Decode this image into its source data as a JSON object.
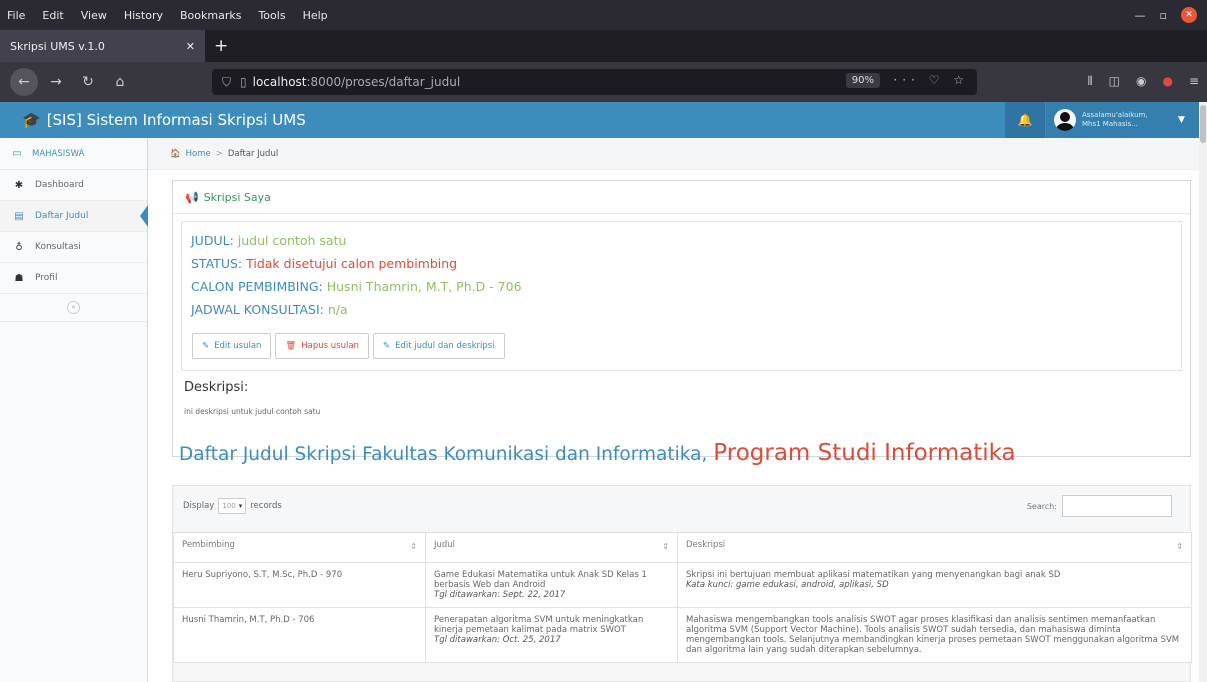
{
  "browser": {
    "menu": [
      "File",
      "Edit",
      "View",
      "History",
      "Bookmarks",
      "Tools",
      "Help"
    ],
    "tab_title": "Skripsi UMS v.1.0",
    "url_host": "localhost",
    "url_path": ":8000/proses/daftar_judul",
    "zoom": "90%"
  },
  "header": {
    "brand": "[SIS] Sistem Informasi Skripsi UMS",
    "user_line1": "Assalamu'alaikum,",
    "user_line2": "Mhs1 Mahasis..."
  },
  "sidebar": {
    "section": "MAHASISWA",
    "items": [
      {
        "label": "Dashboard"
      },
      {
        "label": "Daftar Judul"
      },
      {
        "label": "Konsultasi"
      },
      {
        "label": "Profil"
      }
    ]
  },
  "breadcrumb": {
    "home": "Home",
    "sep": ">",
    "current": "Daftar Judul"
  },
  "skripsi": {
    "title": "Skripsi Saya",
    "judul_label": "JUDUL:",
    "judul_value": "judul contoh satu",
    "status_label": "STATUS:",
    "status_value": "Tidak disetujui calon pembimbing",
    "calon_label": "CALON PEMBIMBING:",
    "calon_value": "Husni Thamrin, M.T, Ph.D - 706",
    "jadwal_label": "JADWAL KONSULTASI:",
    "jadwal_value": "n/a",
    "btn_edit_usulan": "Edit usulan",
    "btn_hapus_usulan": "Hapus usulan",
    "btn_edit_judul": "Edit judul dan deskripsi",
    "deskripsi_label": "Deskripsi:",
    "deskripsi_text": "ini deskripsi untuk judul contoh satu"
  },
  "daftar": {
    "heading": "Daftar Judul Skripsi Fakultas Komunikasi dan Informatika,",
    "program": "Program Studi Informatika",
    "display_label": "Display",
    "display_value": "100",
    "records_label": "records",
    "search_label": "Search:",
    "columns": [
      "Pembimbing",
      "Judul",
      "Deskripsi"
    ],
    "rows": [
      {
        "pembimbing": "Heru Supriyono, S.T, M.Sc, Ph.D - 970",
        "judul": "Game Edukasi Matematika untuk Anak SD Kelas 1 berbasis Web dan Android",
        "tgl": "Tgl ditawarkan: Sept. 22, 2017",
        "deskripsi": "Skripsi ini bertujuan membuat aplikasi matematikan yang menyenangkan bagi anak SD",
        "kata_kunci": "Kata kunci: game edukasi, android, aplikasi, SD"
      },
      {
        "pembimbing": "Husni Thamrin, M.T, Ph.D - 706",
        "judul": "Penerapatan algoritma SVM untuk meningkatkan kinerja pemetaan kalimat pada matrix SWOT",
        "tgl": "Tgl ditawarkan: Oct. 25, 2017",
        "deskripsi": "Mahasiswa mengembangkan tools analisis SWOT agar proses klasifikasi dan analisis sentimen memanfaatkan algoritma SVM (Support Vector Machine). Tools analisis SWOT sudah tersedia, dan mahasiswa diminta mengembangkan tools. Selanjutnya membandingkan kinerja proses pemetaan SWOT menggunakan algoritma SVM dan algoritma lain yang sudah diterapkan sebelumnya.",
        "kata_kunci": ""
      }
    ]
  }
}
